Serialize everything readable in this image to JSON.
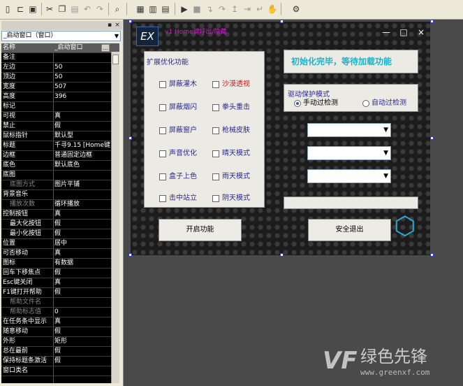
{
  "panel": {
    "title_pin": "▪",
    "title_close": "×",
    "combo": "_启动窗口（窗口）",
    "combo_arrow": "▼",
    "dots": "…",
    "props": [
      [
        "名称",
        "_启动窗口"
      ],
      [
        "备注",
        ""
      ],
      [
        "左边",
        "50"
      ],
      [
        "顶边",
        "50"
      ],
      [
        "宽度",
        "507"
      ],
      [
        "高度",
        "396"
      ],
      [
        "标记",
        ""
      ],
      [
        "可视",
        "真"
      ],
      [
        "禁止",
        "假"
      ],
      [
        "鼠标指针",
        "默认型"
      ],
      [
        "标题",
        "千寻9.15 [Home键"
      ],
      [
        "边框",
        "普通固定边框"
      ],
      [
        "底色",
        "默认底色"
      ],
      [
        "底图",
        ""
      ],
      [
        "底图方式",
        "图片平铺"
      ],
      [
        "背景音乐",
        ""
      ],
      [
        "播放次数",
        "循环播放"
      ],
      [
        "控制按钮",
        "真"
      ],
      [
        "最大化按钮",
        "假"
      ],
      [
        "最小化按钮",
        "假"
      ],
      [
        "位置",
        "居中"
      ],
      [
        "可否移动",
        "真"
      ],
      [
        "图标",
        "有数据"
      ],
      [
        "回车下移焦点",
        "假"
      ],
      [
        "Esc键关闭",
        "真"
      ],
      [
        "F1键打开帮助",
        "假"
      ],
      [
        "帮助文件名",
        ""
      ],
      [
        "帮助标志值",
        "0"
      ],
      [
        "在任务条中显示",
        "真"
      ],
      [
        "随意移动",
        "假"
      ],
      [
        "外形",
        "矩形"
      ],
      [
        "总在最前",
        "假"
      ],
      [
        "保持标题条激活",
        "假"
      ],
      [
        "窗口类名",
        ""
      ]
    ]
  },
  "form": {
    "logo": "EX",
    "title": "v1 Home键呼出/隐藏",
    "min": "—",
    "max": "□",
    "close": "×",
    "group_title": "扩展优化功能",
    "checks_left": [
      "屏蔽灌木",
      "屏蔽烟闪",
      "屏蔽窗户",
      "声音优化",
      "盒子上色",
      "击中站立"
    ],
    "checks_right": [
      "沙漠透视",
      "拳头重击",
      "枪械皮肤",
      "晴天模式",
      "雨天模式",
      "阴天模式"
    ],
    "status": "初始化完毕，等待加载功能",
    "driver_group": "驱动保护模式",
    "radio_manual": "手动过检测",
    "radio_auto": "自动过检测",
    "dd_arrow": "▼",
    "btn_start": "开启功能",
    "btn_exit": "安全退出",
    "hex": "⬡"
  },
  "watermark": {
    "logo": "VF",
    "text": "绿色先锋",
    "url": "www.greenxf.com"
  }
}
